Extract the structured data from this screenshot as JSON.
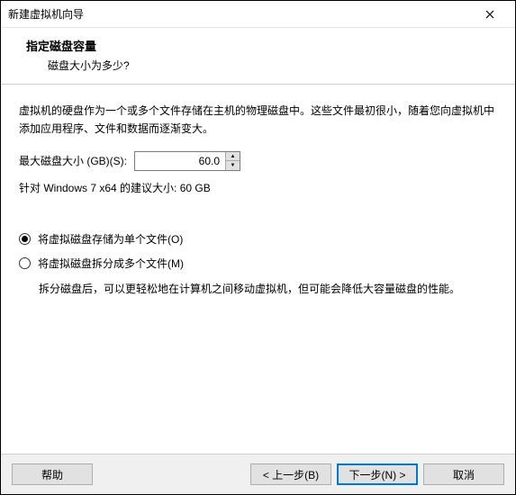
{
  "window": {
    "title": "新建虚拟机向导"
  },
  "header": {
    "title": "指定磁盘容量",
    "subtitle": "磁盘大小为多少?"
  },
  "body": {
    "description": "虚拟机的硬盘作为一个或多个文件存储在主机的物理磁盘中。这些文件最初很小，随着您向虚拟机中添加应用程序、文件和数据而逐渐变大。",
    "size_label": "最大磁盘大小 (GB)(S):",
    "size_value": "60.0",
    "recommendation": "针对 Windows 7 x64 的建议大小: 60 GB",
    "radio": {
      "single": "将虚拟磁盘存储为单个文件(O)",
      "split": "将虚拟磁盘拆分成多个文件(M)",
      "split_hint": "拆分磁盘后，可以更轻松地在计算机之间移动虚拟机，但可能会降低大容量磁盘的性能。",
      "selected": "single"
    }
  },
  "footer": {
    "help": "帮助",
    "back": "< 上一步(B)",
    "next": "下一步(N) >",
    "cancel": "取消"
  }
}
